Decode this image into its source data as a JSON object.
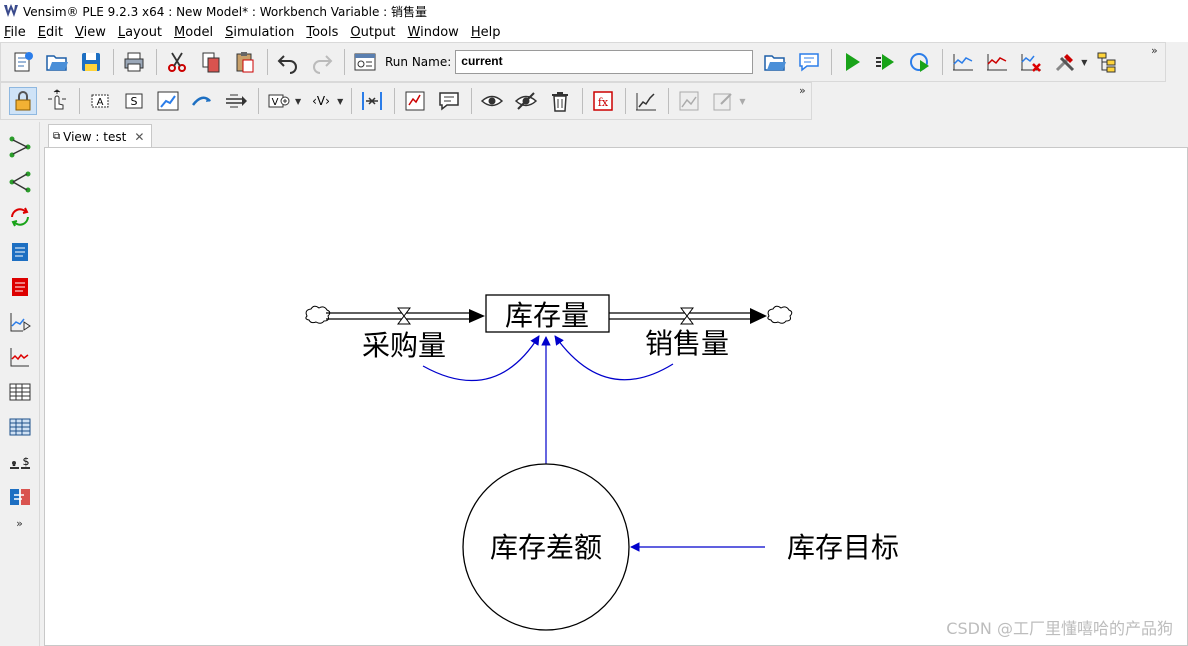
{
  "window": {
    "title": "Vensim® PLE 9.2.3 x64 : New Model* : Workbench Variable : 销售量"
  },
  "menu": {
    "items": [
      {
        "label": "File",
        "key": "F",
        "rest": "ile"
      },
      {
        "label": "Edit",
        "key": "E",
        "rest": "dit"
      },
      {
        "label": "View",
        "key": "V",
        "rest": "iew"
      },
      {
        "label": "Layout",
        "key": "L",
        "rest": "ayout"
      },
      {
        "label": "Model",
        "key": "M",
        "rest": "odel"
      },
      {
        "label": "Simulation",
        "key": "S",
        "rest": "imulation"
      },
      {
        "label": "Tools",
        "key": "T",
        "rest": "ools"
      },
      {
        "label": "Output",
        "key": "O",
        "rest": "utput"
      },
      {
        "label": "Window",
        "key": "W",
        "rest": "indow"
      },
      {
        "label": "Help",
        "key": "H",
        "rest": "elp"
      }
    ]
  },
  "toolbar": {
    "run_name_label": "Run Name:",
    "run_name_value": "current",
    "more": "»"
  },
  "sidebar": {
    "more": "»"
  },
  "tab": {
    "label": "View : test",
    "close": "✕"
  },
  "diagram": {
    "stock": "库存量",
    "inflow": "采购量",
    "outflow": "销售量",
    "aux1": "库存差额",
    "aux2": "库存目标",
    "colors": {
      "link": "#0000cc",
      "line": "#000000"
    }
  },
  "watermark": "CSDN @工厂里懂嘻哈的产品狗"
}
